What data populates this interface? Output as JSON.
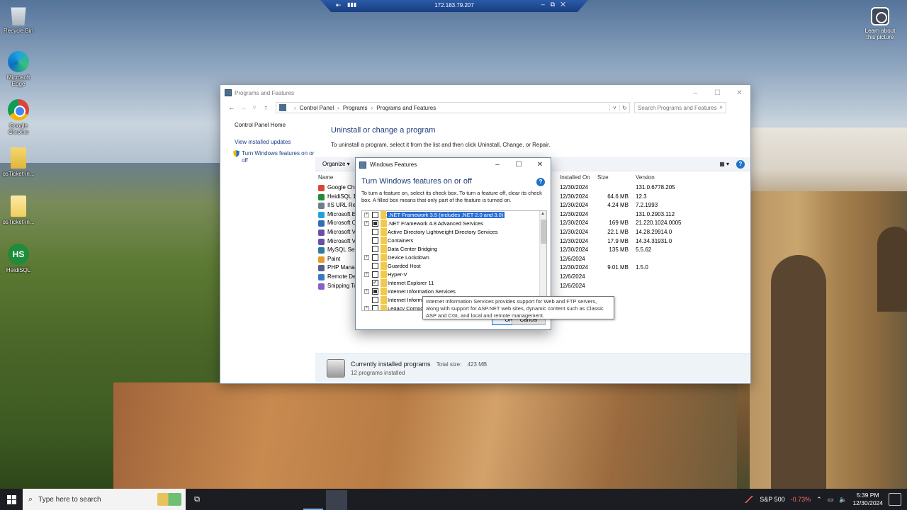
{
  "remote_bar": {
    "ip": "172.183.79.207"
  },
  "desktop": {
    "icons": [
      {
        "label": "Recycle Bin"
      },
      {
        "label": "Microsoft Edge"
      },
      {
        "label": "Google Chrome"
      },
      {
        "label": "osTicket-in..."
      },
      {
        "label": "osTicket-in..."
      },
      {
        "label": "HeidiSQL"
      }
    ],
    "learn": "Learn about this picture",
    "hs_text": "HS"
  },
  "pf": {
    "title": "Programs and Features",
    "breadcrumb": [
      "Control Panel",
      "Programs",
      "Programs and Features"
    ],
    "search_placeholder": "Search Programs and Features",
    "left": {
      "home": "Control Panel Home",
      "updates": "View installed updates",
      "features": "Turn Windows features on or off"
    },
    "heading": "Uninstall or change a program",
    "description": "To uninstall a program, select it from the list and then click Uninstall, Change, or Repair.",
    "organize": "Organize ▾",
    "columns": {
      "name": "Name",
      "installed_on": "Installed On",
      "size": "Size",
      "version": "Version"
    },
    "rows": [
      {
        "name": "Google Chr",
        "date": "12/30/2024",
        "size": "",
        "version": "131.0.6778.205",
        "color": "#db4437"
      },
      {
        "name": "HeidiSQL 1",
        "date": "12/30/2024",
        "size": "64.6 MB",
        "version": "12.3",
        "color": "#1e8c3a"
      },
      {
        "name": "IIS URL Rew",
        "date": "12/30/2024",
        "size": "4.24 MB",
        "version": "7.2.1993",
        "color": "#6f7e8f"
      },
      {
        "name": "Microsoft E",
        "date": "12/30/2024",
        "size": "",
        "version": "131.0.2903.112",
        "color": "#1fa2e0"
      },
      {
        "name": "Microsoft O",
        "date": "12/30/2024",
        "size": "169 MB",
        "version": "21.220.1024.0005",
        "color": "#2f6fb5"
      },
      {
        "name": "Microsoft V",
        "date": "12/30/2024",
        "size": "22.1 MB",
        "version": "14.28.29914.0",
        "color": "#6a4fa8"
      },
      {
        "name": "Microsoft V",
        "date": "12/30/2024",
        "size": "17.9 MB",
        "version": "14.34.31931.0",
        "color": "#6a4fa8"
      },
      {
        "name": "MySQL Ser",
        "date": "12/30/2024",
        "size": "135 MB",
        "version": "5.5.62",
        "color": "#2e7d9c"
      },
      {
        "name": "Paint",
        "date": "12/6/2024",
        "size": "",
        "version": "",
        "color": "#e89b2e"
      },
      {
        "name": "PHP Manag",
        "date": "12/30/2024",
        "size": "9.01 MB",
        "version": "1.5.0",
        "color": "#555f8a"
      },
      {
        "name": "Remote Des",
        "date": "12/6/2024",
        "size": "",
        "version": "",
        "color": "#3a79c4"
      },
      {
        "name": "Snipping To",
        "date": "12/6/2024",
        "size": "",
        "version": "",
        "color": "#8a5fc9"
      }
    ],
    "status": {
      "title": "Currently installed programs",
      "total_label": "Total size:",
      "total": "423 MB",
      "count": "12 programs installed"
    }
  },
  "wf": {
    "title": "Windows Features",
    "heading": "Turn Windows features on or off",
    "help": "?",
    "description": "To turn a feature on, select its check box. To turn a feature off, clear its check box. A filled box means that only part of the feature is turned on.",
    "features": [
      {
        "label": ".NET Framework 3.5 (includes .NET 2.0 and 3.0)",
        "state": "off",
        "expand": true,
        "selected": true
      },
      {
        "label": ".NET Framework 4.8 Advanced Services",
        "state": "part",
        "expand": true,
        "selected": false
      },
      {
        "label": "Active Directory Lightweight Directory Services",
        "state": "off",
        "expand": false,
        "selected": false
      },
      {
        "label": "Containers",
        "state": "off",
        "expand": false,
        "selected": false
      },
      {
        "label": "Data Center Bridging",
        "state": "off",
        "expand": false,
        "selected": false
      },
      {
        "label": "Device Lockdown",
        "state": "off",
        "expand": true,
        "selected": false
      },
      {
        "label": "Guarded Host",
        "state": "off",
        "expand": false,
        "selected": false
      },
      {
        "label": "Hyper-V",
        "state": "off",
        "expand": true,
        "selected": false
      },
      {
        "label": "Internet Explorer 11",
        "state": "on",
        "expand": false,
        "selected": false
      },
      {
        "label": "Internet Information Services",
        "state": "part",
        "expand": true,
        "selected": false
      },
      {
        "label": "Internet Inform",
        "state": "off",
        "expand": false,
        "selected": false
      },
      {
        "label": "Legacy Compo",
        "state": "off",
        "expand": true,
        "selected": false
      }
    ],
    "ok": "OK",
    "cancel": "Cancel",
    "tooltip": "Internet Information Services provides support for Web and FTP servers, along with support for ASP.NET web sites, dynamic content such as Classic ASP and CGI, and local and remote management."
  },
  "taskbar": {
    "search_placeholder": "Type here to search",
    "ticker_name": "S&P 500",
    "ticker_change": "-0.73%",
    "time": "5:39 PM",
    "date": "12/30/2024"
  }
}
